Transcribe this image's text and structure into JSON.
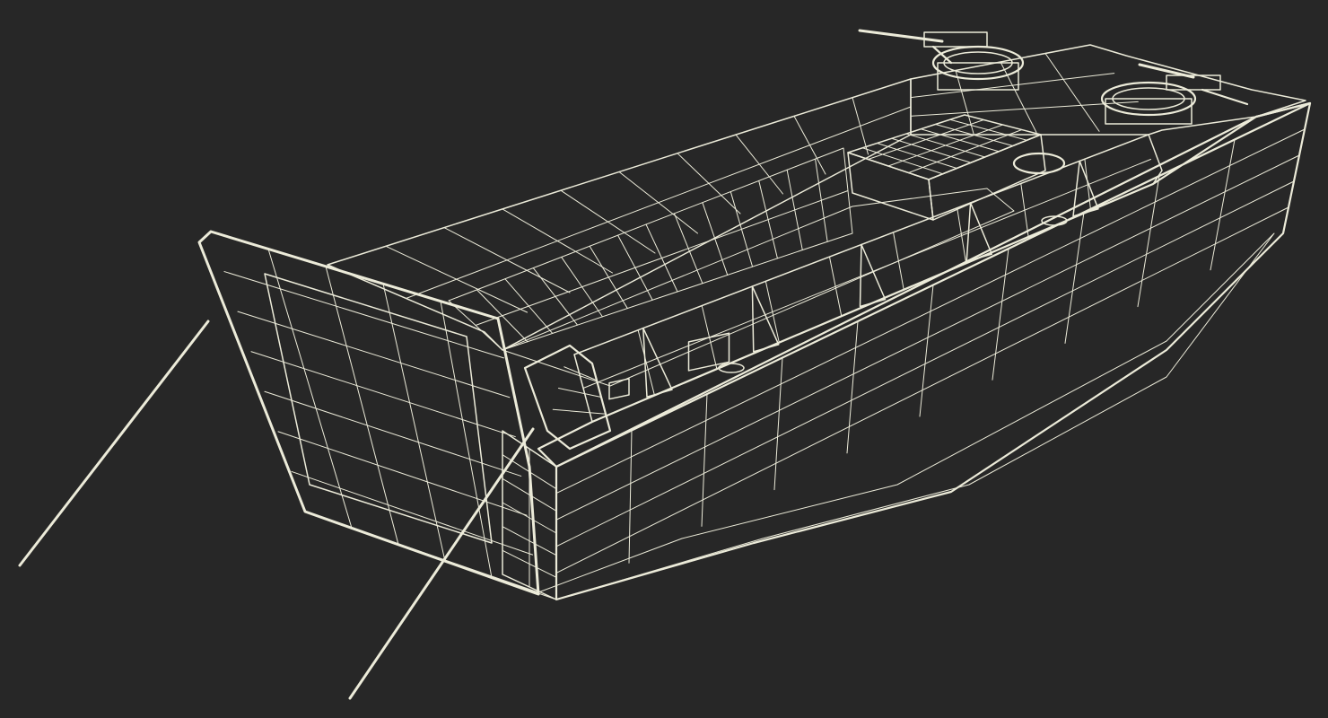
{
  "scene": {
    "subject": "landing-craft-wireframe-model",
    "colors": {
      "background": "#272727",
      "hull_side": "#6d6d66",
      "hull_inner": "#5c5c56",
      "hull_dark": "#3c3c39",
      "deck": "#64645e",
      "ramp_front": "#73736c",
      "wire": "#ecebd9"
    }
  }
}
